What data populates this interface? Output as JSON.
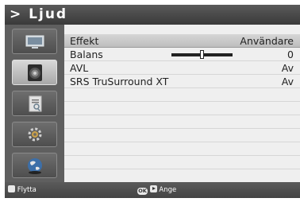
{
  "title": "> Ljud",
  "sidebar": {
    "items": [
      {
        "icon": "tv-icon",
        "active": false
      },
      {
        "icon": "speaker-icon",
        "active": true
      },
      {
        "icon": "clipboard-icon",
        "active": false
      },
      {
        "icon": "gear-icon",
        "active": false
      },
      {
        "icon": "globe-icon",
        "active": false
      }
    ]
  },
  "menu": {
    "rows": [
      {
        "label": "Effekt",
        "value": "Användare"
      },
      {
        "label": "Balans",
        "value": "0",
        "slider_level": 0.5
      },
      {
        "label": "AVL",
        "value": "Av"
      },
      {
        "label": "SRS TruSurround XT",
        "value": "Av"
      }
    ]
  },
  "footer": {
    "move_label": "Flytta",
    "ok_label": "OK",
    "enter_label": "Ange"
  }
}
